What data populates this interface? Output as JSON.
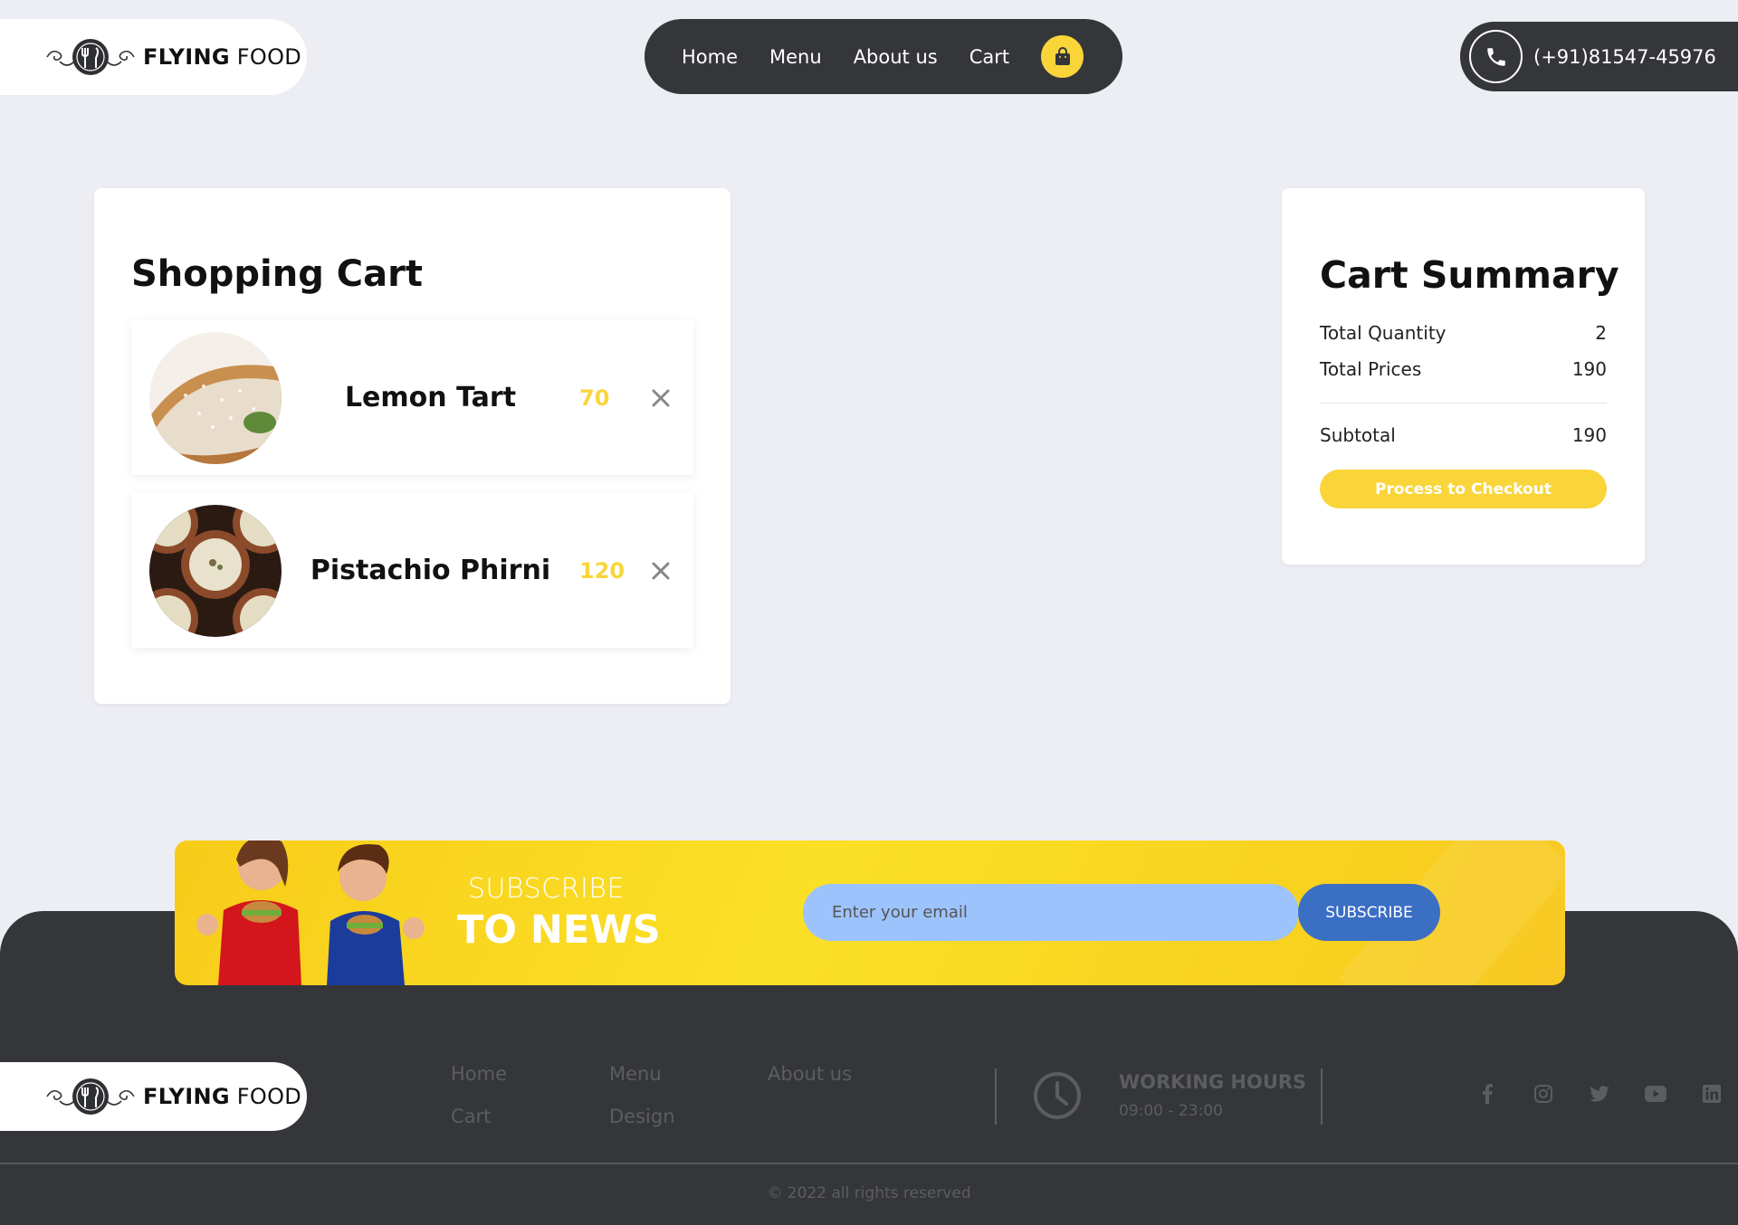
{
  "brand": {
    "name_bold": "FLYING",
    "name_light": "FOOD"
  },
  "nav": {
    "items": [
      "Home",
      "Menu",
      "About us",
      "Cart"
    ],
    "cart_icon": "shopping-bag-icon"
  },
  "phone": {
    "number": "(+91)81547-45976",
    "icon": "phone-icon"
  },
  "cart": {
    "title": "Shopping Cart",
    "items": [
      {
        "name": "Lemon Tart",
        "price": "70",
        "image": "lemon-tart-photo"
      },
      {
        "name": "Pistachio Phirni",
        "price": "120",
        "image": "pistachio-phirni-photo"
      }
    ]
  },
  "summary": {
    "title": "Cart Summary",
    "total_quantity_label": "Total Quantity",
    "total_quantity": "2",
    "total_prices_label": "Total Prices",
    "total_prices": "190",
    "subtotal_label": "Subtotal",
    "subtotal": "190",
    "checkout_label": "Process to Checkout"
  },
  "newsletter": {
    "line1": "SUBSCRIBE",
    "line2": "TO NEWS",
    "email_placeholder": "Enter your email",
    "button": "SUBSCRIBE"
  },
  "footer": {
    "links": [
      "Home",
      "Menu",
      "About us",
      "Cart",
      "Design"
    ],
    "hours_title": "WORKING HOURS",
    "hours_time": "09:00 - 23:00",
    "socials": [
      "facebook-icon",
      "instagram-icon",
      "twitter-icon",
      "youtube-icon",
      "linkedin-icon"
    ],
    "copyright": "© 2022 all rights reserved"
  },
  "colors": {
    "accent": "#f9d53a",
    "dark": "#35363a",
    "page_bg": "#edeef3",
    "subscribe_blue": "#3b6fc4"
  }
}
